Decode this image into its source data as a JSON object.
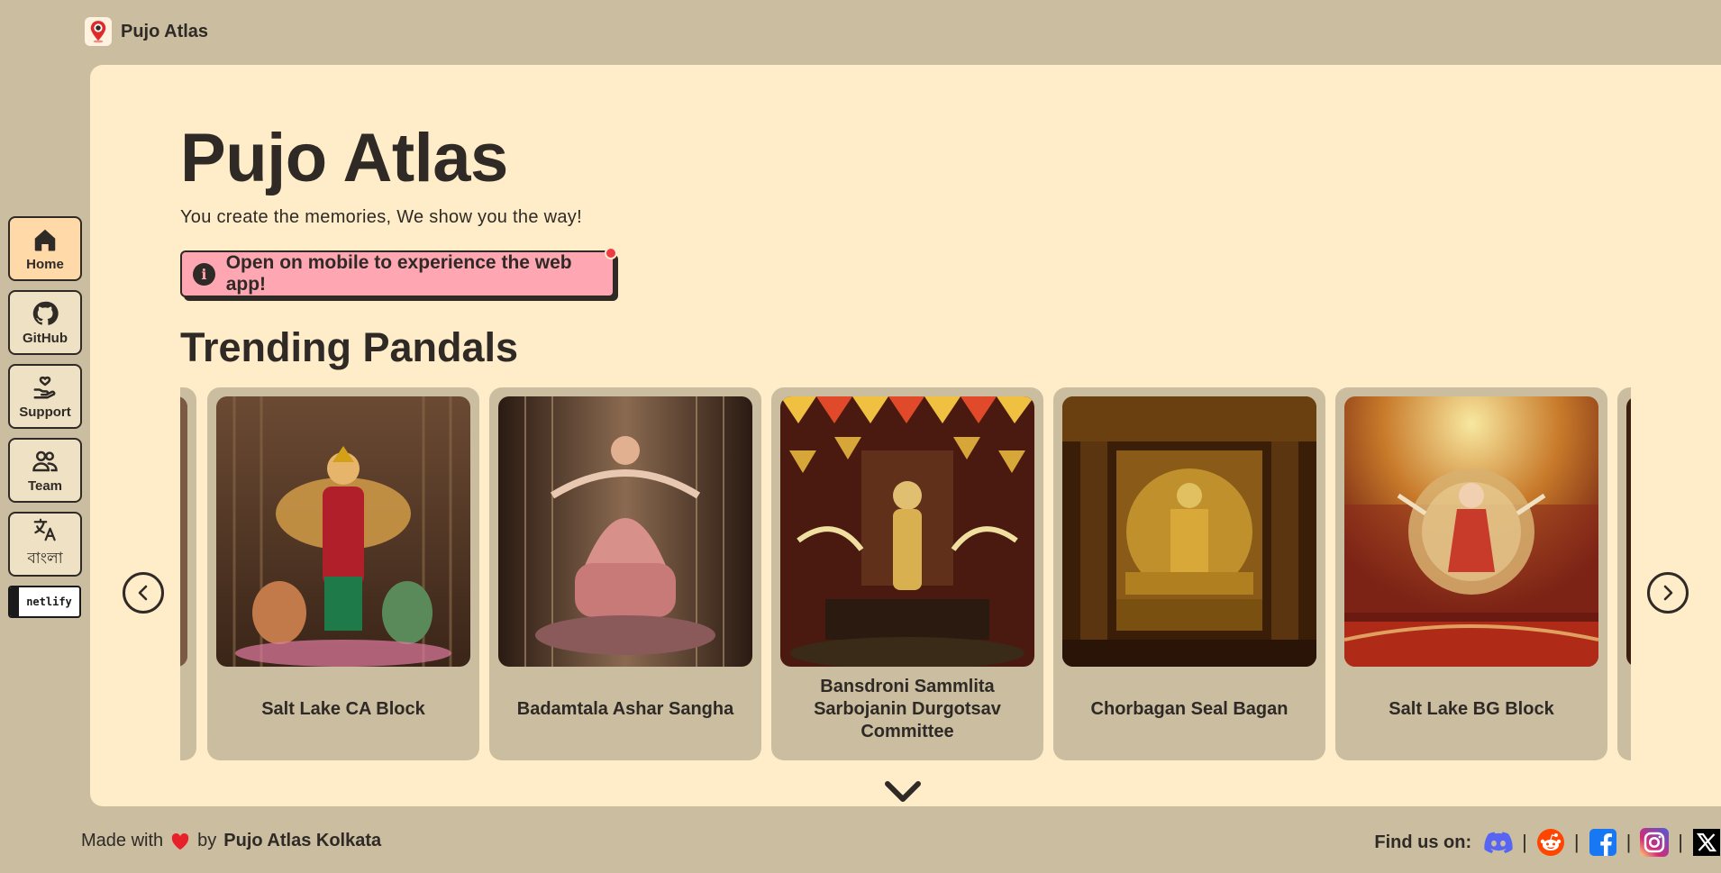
{
  "app": {
    "title": "Pujo Atlas"
  },
  "nav": [
    {
      "label": "Home",
      "icon": "home-icon",
      "active": true
    },
    {
      "label": "GitHub",
      "icon": "github-icon"
    },
    {
      "label": "Support",
      "icon": "support-icon"
    },
    {
      "label": "Team",
      "icon": "team-icon"
    },
    {
      "label": "বাংলা",
      "icon": "translate-icon"
    }
  ],
  "netlify_badge": "netlify",
  "hero": {
    "title": "Pujo Atlas",
    "subtitle": "You create the memories, We show you the way!"
  },
  "alert": {
    "text": "Open on mobile to experience the web app!",
    "icon": "info-icon"
  },
  "trending": {
    "title": "Trending Pandals",
    "cards": [
      {
        "name": "Salt Lake CA Block"
      },
      {
        "name": "Badamtala Ashar Sangha"
      },
      {
        "name": "Bansdroni Sammlita Sarbojanin Durgotsav Committee"
      },
      {
        "name": "Chorbagan Seal Bagan"
      },
      {
        "name": "Salt Lake BG Block"
      }
    ]
  },
  "footer": {
    "made_with": "Made with",
    "by": "by",
    "org": "Pujo Atlas Kolkata",
    "find_us": "Find us on:",
    "socials": [
      "discord-icon",
      "reddit-icon",
      "facebook-icon",
      "instagram-icon",
      "x-icon"
    ]
  },
  "colors": {
    "background": "#cbbd9f",
    "panel": "#ffecc8",
    "alert": "#ffa6b3",
    "text": "#2f2a26",
    "active_nav": "#ffd9a8"
  }
}
